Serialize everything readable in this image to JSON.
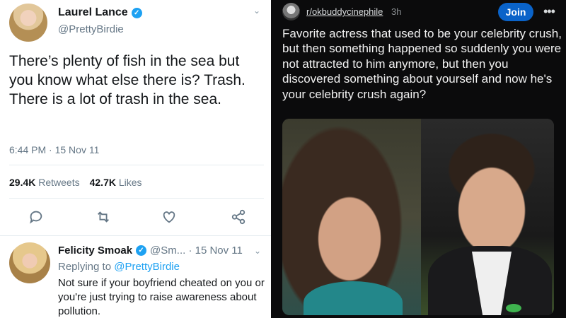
{
  "tweet": {
    "author_name": "Laurel Lance",
    "author_handle": "@PrettyBirdie",
    "text": "There’s plenty of fish in the sea but you know what else there is? Trash. There is a lot of trash in the sea.",
    "timestamp": "6:44 PM · 15 Nov 11",
    "retweets_count": "29.4K",
    "retweets_label": "Retweets",
    "likes_count": "42.7K",
    "likes_label": "Likes",
    "chevron_icon": "chevron-down-icon",
    "action_icons": [
      "reply-icon",
      "retweet-icon",
      "like-icon",
      "share-icon"
    ]
  },
  "reply": {
    "author_name": "Felicity Smoak",
    "handle_and_date": "@Sm... · 15 Nov 11",
    "replying_prefix": "Replying to",
    "replying_handle": "@PrettyBirdie",
    "text": "Not sure if your boyfriend cheated on you or you're just trying to raise awareness about pollution."
  },
  "reddit": {
    "subreddit": "r/okbuddycinephile",
    "age": "3h",
    "join_label": "Join",
    "more_label": "•••",
    "title": "Favorite actress that used to be your celebrity crush, but then something happened so suddenly you were not attracted to him anymore, but then you discovered something about yourself and now he's your celebrity crush again?",
    "accent_color": "#0a63c9"
  },
  "colors": {
    "twitter_blue": "#1da1f2",
    "twitter_gray": "#657786",
    "reddit_bg": "#0b0b0c"
  }
}
